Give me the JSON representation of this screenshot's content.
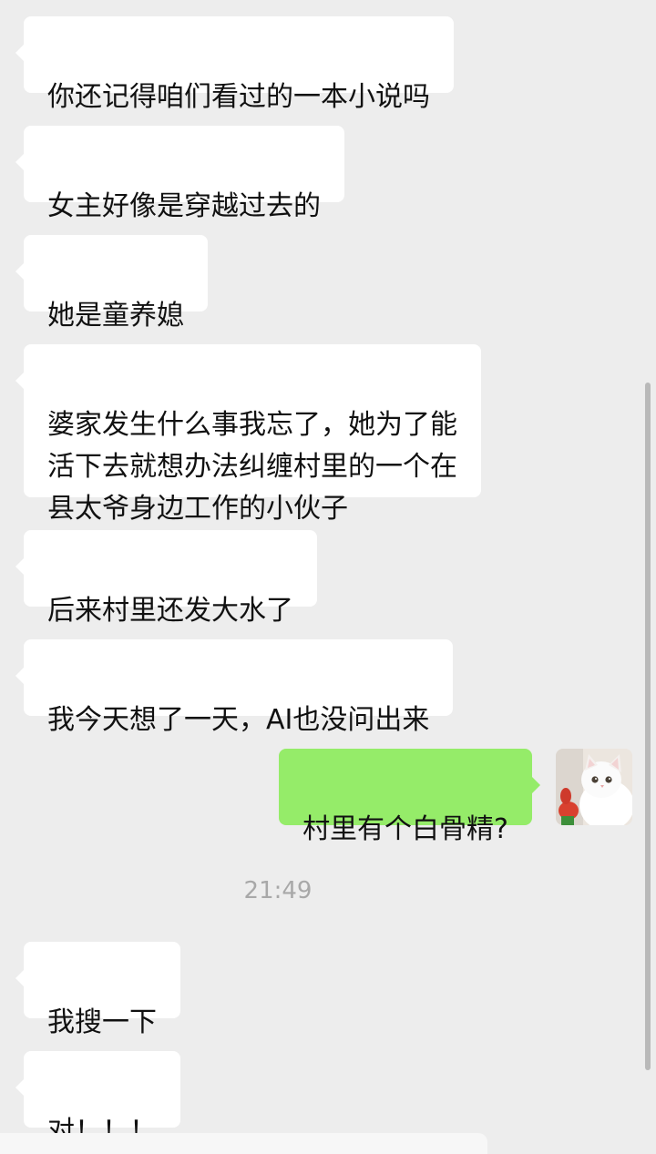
{
  "messages": [
    {
      "text": "你还记得咱们看过的一本小说吗"
    },
    {
      "text": "女主好像是穿越过去的"
    },
    {
      "text": "她是童养媳"
    },
    {
      "text": "婆家发生什么事我忘了，她为了能\n活下去就想办法纠缠村里的一个在\n县太爷身边工作的小伙子"
    },
    {
      "text": "后来村里还发大水了"
    },
    {
      "text": "我今天想了一天，AI也没问出来"
    },
    {
      "text": "村里有个白骨精?"
    },
    {
      "text": "我搜一下"
    },
    {
      "text": "对！！！"
    }
  ],
  "timestamp": "21:49",
  "avatar": {
    "icon": "cat-avatar-icon"
  },
  "colors": {
    "background": "#ededed",
    "incoming_bubble": "#ffffff",
    "outgoing_bubble": "#95ec69",
    "timestamp_text": "#a8a8a8"
  }
}
